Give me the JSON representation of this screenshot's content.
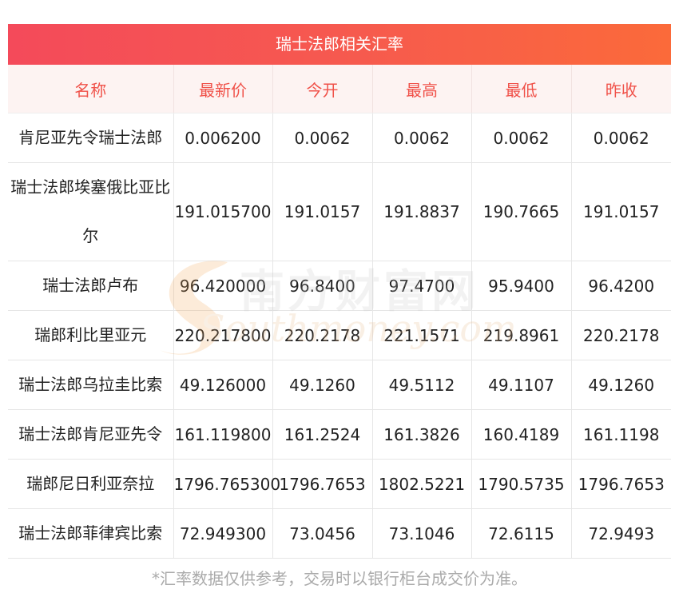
{
  "title": "瑞士法郎相关汇率",
  "headers": [
    "名称",
    "最新价",
    "今开",
    "最高",
    "最低",
    "昨收"
  ],
  "rows": [
    [
      "肯尼亚先令瑞士法郎",
      "0.006200",
      "0.0062",
      "0.0062",
      "0.0062",
      "0.0062"
    ],
    [
      "瑞士法郎埃塞俄比亚比尔",
      "191.015700",
      "191.0157",
      "191.8837",
      "190.7665",
      "191.0157"
    ],
    [
      "瑞士法郎卢布",
      "96.420000",
      "96.8400",
      "97.4700",
      "95.9400",
      "96.4200"
    ],
    [
      "瑞郎利比里亚元",
      "220.217800",
      "220.2178",
      "221.1571",
      "219.8961",
      "220.2178"
    ],
    [
      "瑞士法郎乌拉圭比索",
      "49.126000",
      "49.1260",
      "49.5112",
      "49.1107",
      "49.1260"
    ],
    [
      "瑞士法郎肯尼亚先令",
      "161.119800",
      "161.2524",
      "161.3826",
      "160.4189",
      "161.1198"
    ],
    [
      "瑞郎尼日利亚奈拉",
      "1796.765300",
      "1796.7653",
      "1802.5221",
      "1790.5735",
      "1796.7653"
    ],
    [
      "瑞士法郎菲律宾比索",
      "72.949300",
      "73.0456",
      "73.1046",
      "72.6115",
      "72.9493"
    ]
  ],
  "footnote": "*汇率数据仅供参考，交易时以银行柜台成交价为准。",
  "watermark": {
    "cn": "南方财富网",
    "en": "Southmoney.com"
  },
  "colors": {
    "header_text": "#f0524a",
    "title_gradient_start": "#f44a5a",
    "title_gradient_end": "#fb6a3a"
  }
}
